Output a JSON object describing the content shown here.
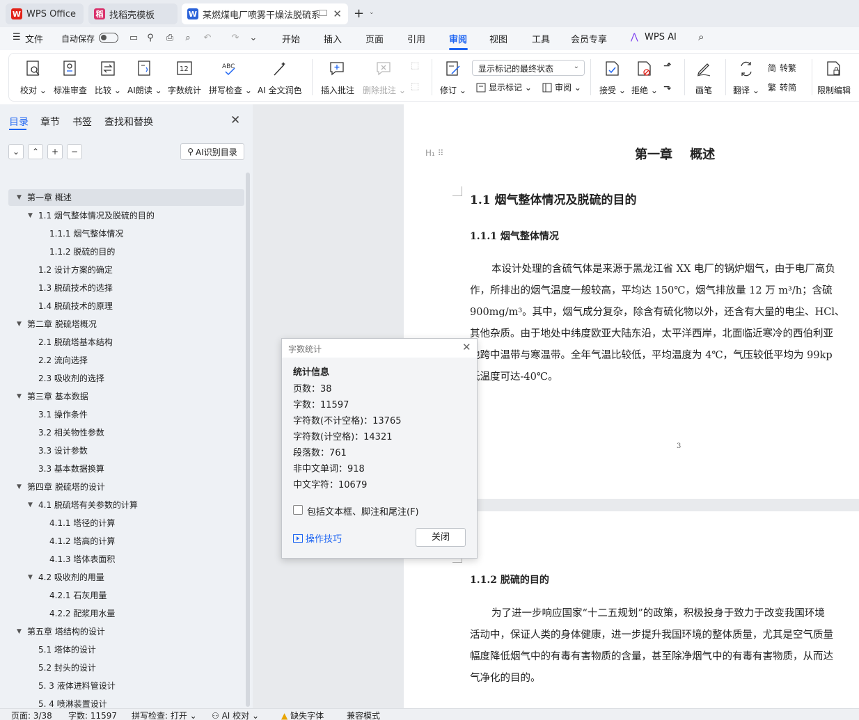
{
  "tabs": {
    "wps": "WPS Office",
    "template": "找稻壳模板",
    "document": "某燃煤电厂喷雾干燥法脱硫系"
  },
  "menu": {
    "file": "文件",
    "autosave": "自动保存",
    "items": [
      "开始",
      "插入",
      "页面",
      "引用",
      "审阅",
      "视图",
      "工具",
      "会员专享",
      "WPS AI"
    ],
    "active": "审阅"
  },
  "ribbon": {
    "proofread": "校对",
    "standard_review": "标准审查",
    "compare": "比较",
    "ai_read": "AI朗读",
    "word_count": "字数统计",
    "spell_check": "拼写检查",
    "ai_polish": "AI 全文润色",
    "insert_comment": "插入批注",
    "delete_comment": "删除批注",
    "track_changes": "修订",
    "markup_state": "显示标记的最终状态",
    "show_markup": "显示标记",
    "review_pane": "审阅",
    "accept": "接受",
    "reject": "拒绝",
    "pen": "画笔",
    "translate": "翻译",
    "to_traditional": "转繁",
    "to_simplified": "转简",
    "restrict_editing": "限制编辑"
  },
  "panel": {
    "tabs": [
      "目录",
      "章节",
      "书签",
      "查找和替换"
    ],
    "ai_toc": "AI识别目录",
    "toc": [
      {
        "text": "第一章    概述",
        "level": 1,
        "caret": true,
        "active": true
      },
      {
        "text": "1.1 烟气整体情况及脱硫的目的",
        "level": 2,
        "caret": true
      },
      {
        "text": "1.1.1 烟气整体情况",
        "level": 3
      },
      {
        "text": "1.1.2 脱硫的目的",
        "level": 3
      },
      {
        "text": "1.2 设计方案的确定",
        "level": 2
      },
      {
        "text": "1.3 脱硫技术的选择",
        "level": 2
      },
      {
        "text": "1.4 脱硫技术的原理",
        "level": 2
      },
      {
        "text": "第二章  脱硫塔概况",
        "level": 1,
        "caret": true
      },
      {
        "text": "2.1 脱硫塔基本结构",
        "level": 2
      },
      {
        "text": "2.2  流向选择",
        "level": 2
      },
      {
        "text": "2.3  吸收剂的选择",
        "level": 2
      },
      {
        "text": "第三章  基本数据",
        "level": 1,
        "caret": true
      },
      {
        "text": "3.1 操作条件",
        "level": 2
      },
      {
        "text": "3.2 相关物性参数",
        "level": 2
      },
      {
        "text": "3.3  设计参数",
        "level": 2
      },
      {
        "text": "3.3 基本数据换算",
        "level": 2
      },
      {
        "text": "第四章    脱硫塔的设计",
        "level": 1,
        "caret": true
      },
      {
        "text": "4.1 脱硫塔有关参数的计算",
        "level": 2,
        "caret": true
      },
      {
        "text": "4.1.1  塔径的计算",
        "level": 3
      },
      {
        "text": "4.1.2  塔高的计算",
        "level": 3
      },
      {
        "text": "4.1.3  塔体表面积",
        "level": 3
      },
      {
        "text": "4.2  吸收剂的用量",
        "level": 2,
        "caret": true
      },
      {
        "text": "4.2.1 石灰用量",
        "level": 3
      },
      {
        "text": "4.2.2 配浆用水量",
        "level": 3
      },
      {
        "text": "第五章  塔结构的设计",
        "level": 1,
        "caret": true
      },
      {
        "text": "5.1 塔体的设计",
        "level": 2
      },
      {
        "text": "5.2  封头的设计",
        "level": 2
      },
      {
        "text": "5. 3 液体进料管设计",
        "level": 2
      },
      {
        "text": "5. 4 喷淋装置设计",
        "level": 2
      }
    ]
  },
  "document": {
    "chapter_title": "第一章    概述",
    "h1": "1.1 烟气整体情况及脱硫的目的",
    "h2": "1.1.1 烟气整体情况",
    "para1": [
      "本设计处理的含硫气体是来源于黑龙江省 XX 电厂的锅炉烟气，由于电厂高负",
      "作，所排出的烟气温度一般较高，平均达 150℃，烟气排放量 12 万 m³/h；含硫",
      "900mg/m³。其中，烟气成分复杂，除含有硫化物以外，还含有大量的电尘、HCl、",
      "其他杂质。由于地处中纬度欧亚大陆东沿，太平洋西岸，北面临近寒冷的西伯利亚",
      "地跨中温带与寒温带。全年气温比较低，平均温度为 4℃，气压较低平均为 99kp",
      "低温度可达-40℃。"
    ],
    "page_number": "3",
    "h3": "1.1.2 脱硫的目的",
    "para2": [
      "为了进一步响应国家“十二五规划”的政策，积极投身于致力于改变我国环境",
      "活动中，保证人类的身体健康，进一步提升我国环境的整体质量，尤其是空气质量",
      "幅度降低烟气中的有毒有害物质的含量，甚至除净烟气中的有毒有害物质，从而达",
      "气净化的目的。"
    ]
  },
  "dialog": {
    "title": "字数统计",
    "subtitle": "统计信息",
    "stats": [
      "页数：38",
      "字数：11597",
      "字符数(不计空格)：13765",
      "字符数(计空格)：14321",
      "段落数：761",
      "非中文单词：918",
      "中文字符：10679"
    ],
    "include_label": "包括文本框、脚注和尾注(F)",
    "include_checked": false,
    "tips": "操作技巧",
    "close": "关闭"
  },
  "status": {
    "page": "页面: 3/38",
    "words": "字数: 11597",
    "spell": "拼写检查: 打开",
    "ai_proof": "AI 校对",
    "missing_font": "缺失字体",
    "compat": "兼容模式"
  },
  "colors": {
    "accent": "#1d64f2",
    "wps_red": "#e2231a",
    "doc_blue": "#2a62d9",
    "template_pink": "#d9316b"
  }
}
